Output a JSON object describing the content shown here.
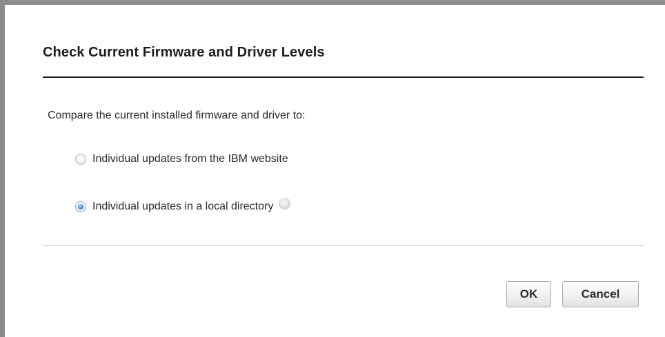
{
  "dialog": {
    "title": "Check Current Firmware and Driver Levels",
    "prompt": "Compare the current installed firmware and driver to:",
    "options": [
      {
        "label": "Individual updates from the IBM website",
        "selected": false
      },
      {
        "label": "Individual updates in a local directory",
        "selected": true,
        "help_icon": "question-mark"
      }
    ],
    "buttons": {
      "ok_label": "OK",
      "cancel_label": "Cancel"
    }
  },
  "colors": {
    "frame_border": "#8c8c8c",
    "title_rule": "#1a1a1a",
    "divider": "#d4d4d4",
    "radio_selected": "#4f86c2"
  }
}
